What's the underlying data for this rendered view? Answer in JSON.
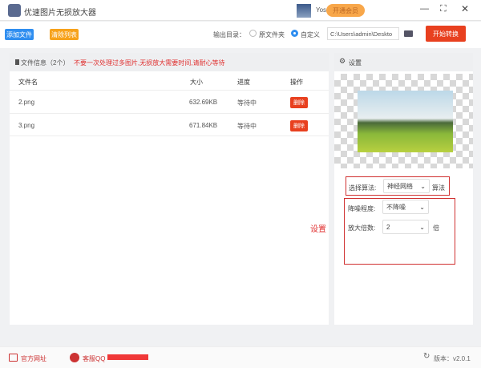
{
  "app": {
    "title": "优速图片无损放大器",
    "user": "Yososoft",
    "vip": "开通会员"
  },
  "toolbar": {
    "add": "添加文件",
    "clear": "清除列表",
    "output_label": "输出目录：",
    "radio_original": "原文件夹",
    "radio_custom": "自定义",
    "path": "C:\\Users\\admin\\Deskto",
    "start": "开始转换"
  },
  "files": {
    "header": "文件信息（2个）",
    "warning": "不要一次处理过多图片,无损放大需要时间,请耐心等待",
    "columns": [
      "文件名",
      "大小",
      "进度",
      "操作"
    ],
    "rows": [
      {
        "name": "2.png",
        "size": "632.69KB",
        "status": "等待中",
        "action": "删除"
      },
      {
        "name": "3.png",
        "size": "671.84KB",
        "status": "等待中",
        "action": "删除"
      }
    ]
  },
  "settings": {
    "title": "设置",
    "algo_label": "选择算法:",
    "algo_value": "神经网络",
    "algo_suffix": "算法",
    "noise_label": "降噪程度:",
    "noise_value": "不降噪",
    "scale_label": "放大倍数:",
    "scale_value": "2",
    "scale_suffix": "倍",
    "annotation": "设置"
  },
  "footer": {
    "website": "官方网址",
    "qq": "客服QQ",
    "version": "版本：v2.0.1"
  },
  "colors": {
    "accent": "#e8401f",
    "blue": "#2f8ef0",
    "orange": "#f7a21b",
    "highlight": "#e03030"
  }
}
